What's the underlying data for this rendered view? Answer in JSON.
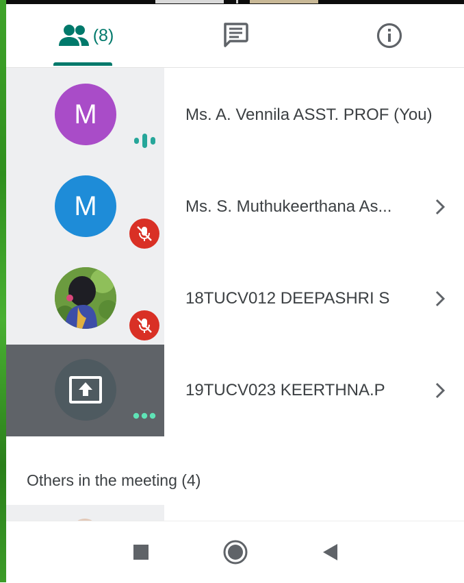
{
  "tabs": {
    "people_count": "(8)",
    "active": "people"
  },
  "participants": [
    {
      "name": "Ms. A. Vennila ASST. PROF (You)",
      "avatar_letter": "M",
      "avatar_color": "#a94cc8",
      "status": "speaking",
      "has_chevron": false
    },
    {
      "name": "Ms. S. Muthukeerthana As...",
      "avatar_letter": "M",
      "avatar_color": "#1e8cd8",
      "status": "muted",
      "has_chevron": true
    },
    {
      "name": "18TUCV012 DEEPASHRI S",
      "avatar_letter": "",
      "avatar_type": "photo",
      "status": "muted",
      "has_chevron": true
    },
    {
      "name": "19TUCV023 KEERTHNA.P",
      "avatar_type": "presenting-icon",
      "status": "presenting",
      "has_chevron": true
    }
  ],
  "others_header": "Others in the meeting (4)",
  "colors": {
    "accent": "#00796b",
    "muted_badge": "#d93025",
    "speaking_indicator": "#26a69a",
    "tile_bg": "#eeeff1",
    "presenting_tile": "#5f6368"
  },
  "icons": {
    "people": "people-icon",
    "chat": "chat-icon",
    "info": "info-icon",
    "mic_off": "mic-off-icon",
    "chevron": "chevron-right-icon",
    "present": "present-screen-icon",
    "more": "more-dots-icon",
    "nav_recent": "square-icon",
    "nav_home": "circle-icon",
    "nav_back": "back-triangle-icon"
  }
}
